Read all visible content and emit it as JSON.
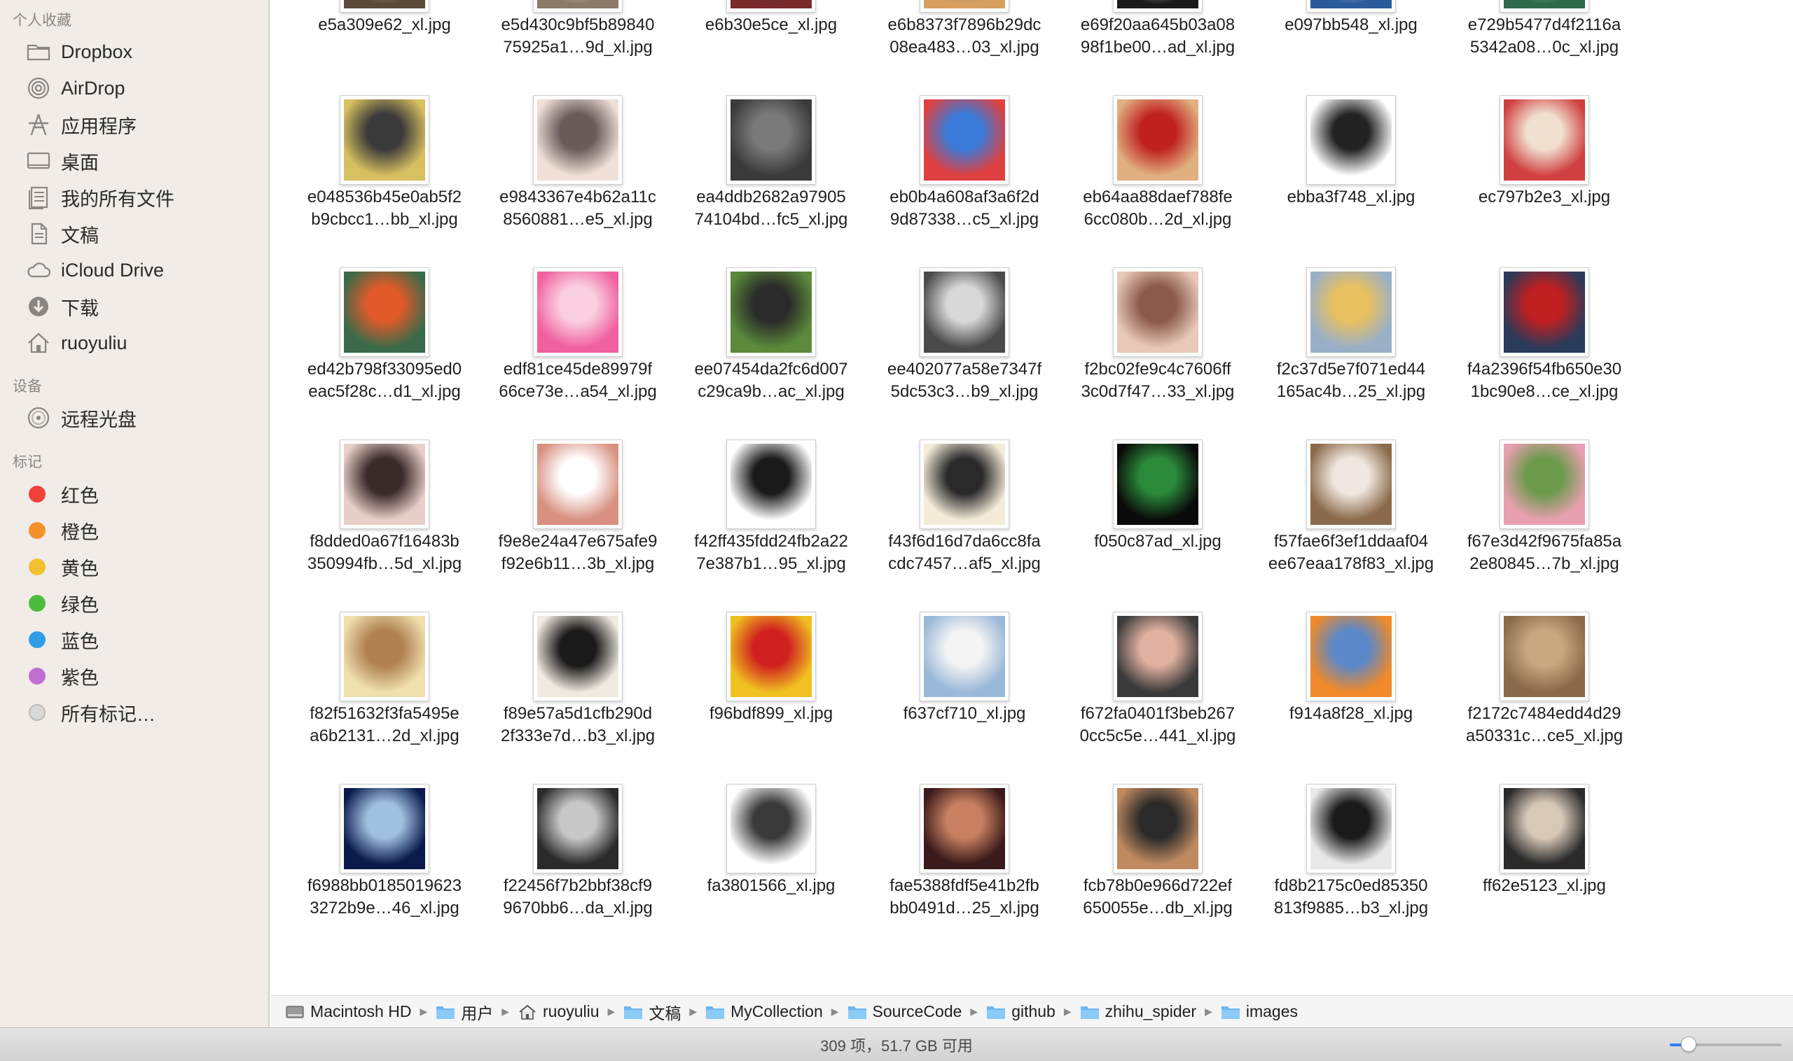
{
  "sidebar": {
    "favorites_header": "个人收藏",
    "favorites": [
      {
        "label": "Dropbox",
        "icon": "folder-icon"
      },
      {
        "label": "AirDrop",
        "icon": "airdrop-icon"
      },
      {
        "label": "应用程序",
        "icon": "applications-icon"
      },
      {
        "label": "桌面",
        "icon": "desktop-icon"
      },
      {
        "label": "我的所有文件",
        "icon": "all-files-icon"
      },
      {
        "label": "文稿",
        "icon": "documents-icon"
      },
      {
        "label": "iCloud Drive",
        "icon": "cloud-icon"
      },
      {
        "label": "下载",
        "icon": "downloads-icon"
      },
      {
        "label": "ruoyuliu",
        "icon": "home-icon"
      }
    ],
    "devices_header": "设备",
    "devices": [
      {
        "label": "远程光盘",
        "icon": "disc-icon"
      }
    ],
    "tags_header": "标记",
    "tags": [
      {
        "label": "红色",
        "color": "#f0413b"
      },
      {
        "label": "橙色",
        "color": "#f4922a"
      },
      {
        "label": "黄色",
        "color": "#f1c12e"
      },
      {
        "label": "绿色",
        "color": "#4cbd3e"
      },
      {
        "label": "蓝色",
        "color": "#2f9ee6"
      },
      {
        "label": "紫色",
        "color": "#c16ed1"
      },
      {
        "label": "所有标记…",
        "color": "#d9d9d9"
      }
    ]
  },
  "files": [
    {
      "l1": "e5a309e62_xl.jpg",
      "l2": ""
    },
    {
      "l1": "e5d430c9bf5b89840",
      "l2": "75925a1…9d_xl.jpg"
    },
    {
      "l1": "e6b30e5ce_xl.jpg",
      "l2": ""
    },
    {
      "l1": "e6b8373f7896b29dc",
      "l2": "08ea483…03_xl.jpg"
    },
    {
      "l1": "e69f20aa645b03a08",
      "l2": "98f1be00…ad_xl.jpg"
    },
    {
      "l1": "e097bb548_xl.jpg",
      "l2": ""
    },
    {
      "l1": "e729b5477d4f2116a",
      "l2": "5342a08…0c_xl.jpg"
    },
    {
      "l1": "e048536b45e0ab5f2",
      "l2": "b9cbcc1…bb_xl.jpg"
    },
    {
      "l1": "e9843367e4b62a11c",
      "l2": "8560881…e5_xl.jpg"
    },
    {
      "l1": "ea4ddb2682a97905",
      "l2": "74104bd…fc5_xl.jpg"
    },
    {
      "l1": "eb0b4a608af3a6f2d",
      "l2": "9d87338…c5_xl.jpg"
    },
    {
      "l1": "eb64aa88daef788fe",
      "l2": "6cc080b…2d_xl.jpg"
    },
    {
      "l1": "ebba3f748_xl.jpg",
      "l2": ""
    },
    {
      "l1": "ec797b2e3_xl.jpg",
      "l2": ""
    },
    {
      "l1": "ed42b798f33095ed0",
      "l2": "eac5f28c…d1_xl.jpg"
    },
    {
      "l1": "edf81ce45de89979f",
      "l2": "66ce73e…a54_xl.jpg"
    },
    {
      "l1": "ee07454da2fc6d007",
      "l2": "c29ca9b…ac_xl.jpg"
    },
    {
      "l1": "ee402077a58e7347f",
      "l2": "5dc53c3…b9_xl.jpg"
    },
    {
      "l1": "f2bc02fe9c4c7606ff",
      "l2": "3c0d7f47…33_xl.jpg"
    },
    {
      "l1": "f2c37d5e7f071ed44",
      "l2": "165ac4b…25_xl.jpg"
    },
    {
      "l1": "f4a2396f54fb650e30",
      "l2": "1bc90e8…ce_xl.jpg"
    },
    {
      "l1": "f8dded0a67f16483b",
      "l2": "350994fb…5d_xl.jpg"
    },
    {
      "l1": "f9e8e24a47e675afe9",
      "l2": "f92e6b11…3b_xl.jpg"
    },
    {
      "l1": "f42ff435fdd24fb2a22",
      "l2": "7e387b1…95_xl.jpg"
    },
    {
      "l1": "f43f6d16d7da6cc8fa",
      "l2": "cdc7457…af5_xl.jpg"
    },
    {
      "l1": "f050c87ad_xl.jpg",
      "l2": ""
    },
    {
      "l1": "f57fae6f3ef1ddaaf04",
      "l2": "ee67eaa178f83_xl.jpg"
    },
    {
      "l1": "f67e3d42f9675fa85a",
      "l2": "2e80845…7b_xl.jpg"
    },
    {
      "l1": "f82f51632f3fa5495e",
      "l2": "a6b2131…2d_xl.jpg"
    },
    {
      "l1": "f89e57a5d1cfb290d",
      "l2": "2f333e7d…b3_xl.jpg"
    },
    {
      "l1": "f96bdf899_xl.jpg",
      "l2": ""
    },
    {
      "l1": "f637cf710_xl.jpg",
      "l2": ""
    },
    {
      "l1": "f672fa0401f3beb267",
      "l2": "0cc5c5e…441_xl.jpg"
    },
    {
      "l1": "f914a8f28_xl.jpg",
      "l2": ""
    },
    {
      "l1": "f2172c7484edd4d29",
      "l2": "a50331c…ce5_xl.jpg"
    },
    {
      "l1": "f6988bb0185019623",
      "l2": "3272b9e…46_xl.jpg"
    },
    {
      "l1": "f22456f7b2bbf38cf9",
      "l2": "9670bb6…da_xl.jpg"
    },
    {
      "l1": "fa3801566_xl.jpg",
      "l2": ""
    },
    {
      "l1": "fae5388fdf5e41b2fb",
      "l2": "bb0491d…25_xl.jpg"
    },
    {
      "l1": "fcb78b0e966d722ef",
      "l2": "650055e…db_xl.jpg"
    },
    {
      "l1": "fd8b2175c0ed85350",
      "l2": "813f9885…b3_xl.jpg"
    },
    {
      "l1": "ff62e5123_xl.jpg",
      "l2": ""
    }
  ],
  "thumb_colors": [
    [
      "#5b4a3a",
      "#c9b79a"
    ],
    [
      "#8a7a66",
      "#e8d8c4"
    ],
    [
      "#7a2a2a",
      "#2a2a2a"
    ],
    [
      "#d8a060",
      "#5a6a7a"
    ],
    [
      "#1a1a1a",
      "#dcdcdc"
    ],
    [
      "#2a5a9a",
      "#d8e4f4"
    ],
    [
      "#2e6a4a",
      "#9ad0b8"
    ],
    [
      "#d8c060",
      "#3a3a3a"
    ],
    [
      "#f0e0d8",
      "#6a5a5a"
    ],
    [
      "#3a3a3a",
      "#7a7a7a"
    ],
    [
      "#e04040",
      "#3a7ad8"
    ],
    [
      "#e0b080",
      "#c02020"
    ],
    [
      "#ffffff",
      "#222222"
    ],
    [
      "#d04040",
      "#f0e0d0"
    ],
    [
      "#3a6a4a",
      "#e05a2a"
    ],
    [
      "#f060a0",
      "#fad0e0"
    ],
    [
      "#5a8a3a",
      "#2a2a2a"
    ],
    [
      "#4a4a4a",
      "#d8d8d8"
    ],
    [
      "#e8c8b8",
      "#8a5a4a"
    ],
    [
      "#9ab0c8",
      "#e8c060"
    ],
    [
      "#2a3a5a",
      "#c02020"
    ],
    [
      "#e8d0c8",
      "#3a2a2a"
    ],
    [
      "#d89080",
      "#ffffff"
    ],
    [
      "#ffffff",
      "#1a1a1a"
    ],
    [
      "#f4ecd8",
      "#2a2a2a"
    ],
    [
      "#0a0a0a",
      "#2a8a3a"
    ],
    [
      "#8a6a4a",
      "#f0e8e0"
    ],
    [
      "#e8a0b0",
      "#6a9a4a"
    ],
    [
      "#f0e0b0",
      "#b08050"
    ],
    [
      "#f0eae0",
      "#1a1a1a"
    ],
    [
      "#f0c020",
      "#d02020"
    ],
    [
      "#9ab8d8",
      "#f4f4f4"
    ],
    [
      "#3a3a3a",
      "#e0b0a0"
    ],
    [
      "#f08a2a",
      "#5a88c8"
    ],
    [
      "#8a6a4a",
      "#c8a880"
    ],
    [
      "#0a1a4a",
      "#a0c0e0"
    ],
    [
      "#2a2a2a",
      "#c8c8c8"
    ],
    [
      "#ffffff",
      "#3a3a3a"
    ],
    [
      "#3a1a1a",
      "#c88060"
    ],
    [
      "#c08a60",
      "#2a2a2a"
    ],
    [
      "#e8e8e8",
      "#1a1a1a"
    ],
    [
      "#2a2a2a",
      "#d8c8b8"
    ]
  ],
  "pathbar": [
    {
      "label": "Macintosh HD",
      "icon": "hard-drive-icon"
    },
    {
      "label": "用户",
      "icon": "folder-icon"
    },
    {
      "label": "ruoyuliu",
      "icon": "home-icon"
    },
    {
      "label": "文稿",
      "icon": "folder-icon"
    },
    {
      "label": "MyCollection",
      "icon": "folder-icon"
    },
    {
      "label": "SourceCode",
      "icon": "folder-icon"
    },
    {
      "label": "github",
      "icon": "folder-icon"
    },
    {
      "label": "zhihu_spider",
      "icon": "folder-icon"
    },
    {
      "label": "images",
      "icon": "folder-icon"
    }
  ],
  "status": {
    "text": "309 项，51.7 GB 可用",
    "zoom_level": 0.17
  }
}
